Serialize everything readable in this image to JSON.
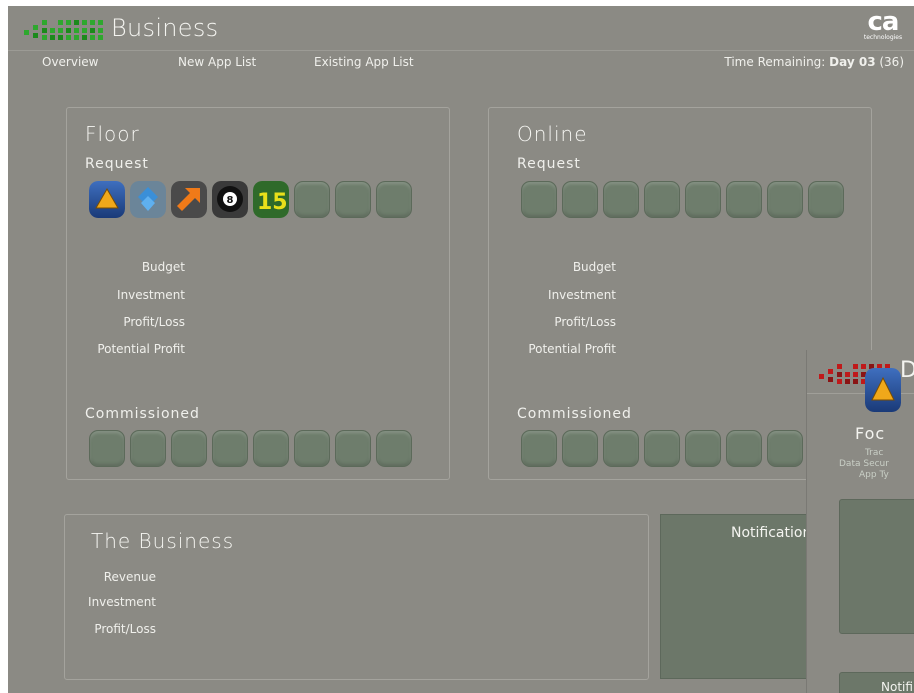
{
  "header": {
    "title": "Business",
    "brand": {
      "mark": "ca",
      "sub": "technologies"
    },
    "colors": {
      "logo_green": "#2ea82e",
      "logo_dark_green": "#1b6e1b",
      "background": "#8b8a84"
    }
  },
  "nav": {
    "items": [
      "Overview",
      "New App List",
      "Existing App List"
    ],
    "time_label": "Time Remaining: ",
    "time_day": "Day 03",
    "time_extra": " (36)"
  },
  "floor": {
    "title": "Floor",
    "request_label": "Request",
    "request_icons": [
      "triangle-app-icon",
      "diamond-app-icon",
      "arrow-app-icon",
      "eight-ball-app-icon",
      "number-15-app-icon"
    ],
    "request_slots": 8,
    "metrics": [
      "Budget",
      "Investment",
      "Profit/Loss",
      "Potential Profit"
    ],
    "commissioned_label": "Commissioned",
    "commissioned_slots": 8
  },
  "online": {
    "title": "Online",
    "request_label": "Request",
    "request_slots": 8,
    "metrics": [
      "Budget",
      "Investment",
      "Profit/Loss",
      "Potential Profit"
    ],
    "commissioned_label": "Commissioned",
    "commissioned_slots": 8
  },
  "business": {
    "title": "The Business",
    "metrics": [
      "Revenue",
      "Investment",
      "Profit/Loss"
    ]
  },
  "notifications": {
    "title": "Notifications"
  },
  "overlay": {
    "title_fragment": "D",
    "colors": {
      "logo_red": "#c0191a"
    },
    "card": {
      "title": "Foc",
      "lines": [
        "Trac",
        "Data Secur",
        "App Ty"
      ]
    },
    "notif_label": "Notifi"
  }
}
